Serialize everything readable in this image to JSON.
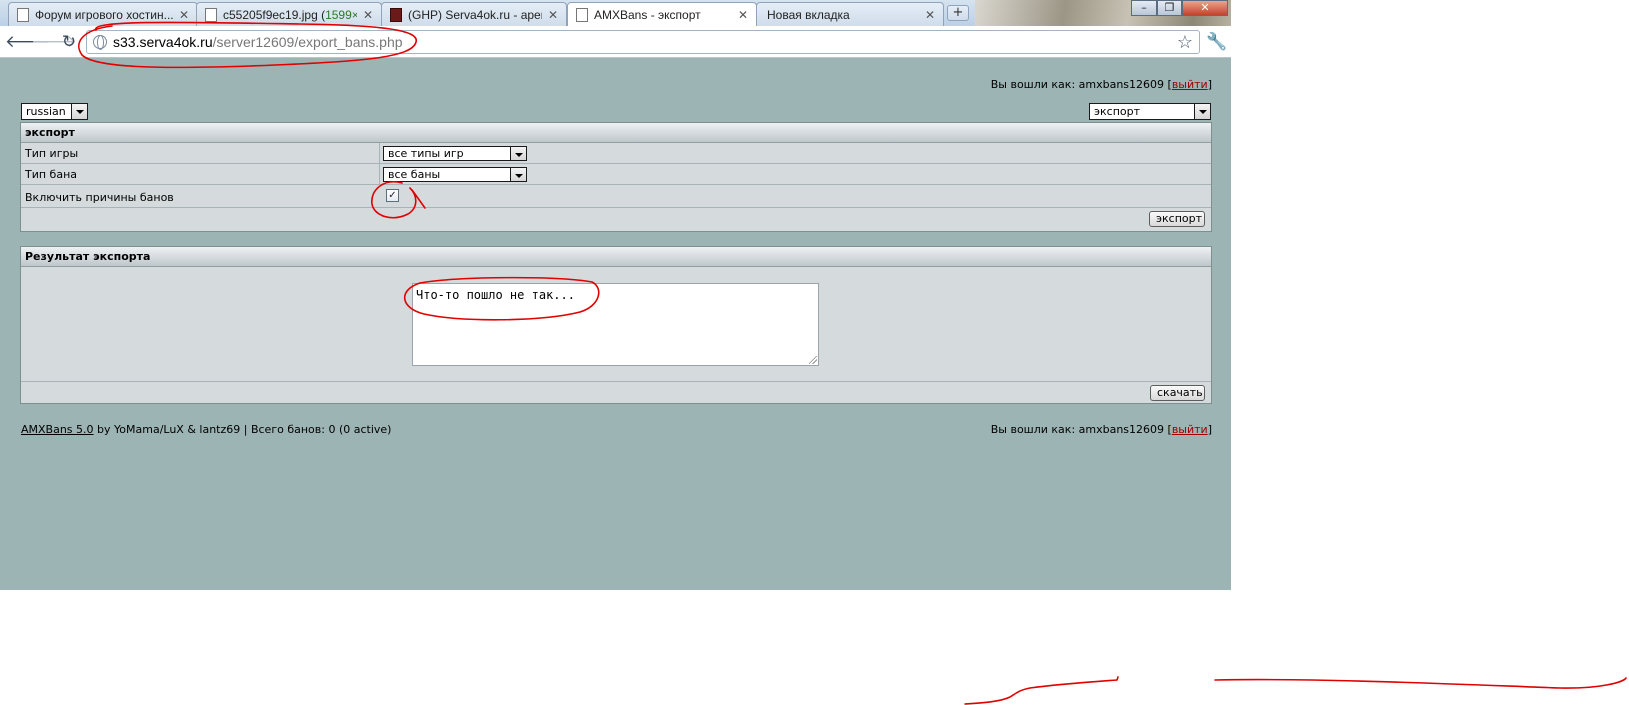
{
  "browser": {
    "tabs": [
      {
        "label": "Форум игрового хостин...",
        "icon": "page-icon",
        "active": false
      },
      {
        "label_a": "c55205f9ec19.jpg (",
        "label_b": "1599×...",
        "icon": "page-icon",
        "active": false
      },
      {
        "label": "(GHP) Serva4ok.ru - арен...",
        "icon": "ghp-favicon-icon",
        "active": false
      },
      {
        "label": "AMXBans - экспорт",
        "icon": "page-icon",
        "active": true
      },
      {
        "label": "Новая вкладка",
        "icon": "none",
        "active": false
      }
    ],
    "url_host": "s33.serva4ok.ru",
    "url_path": "/server12609/export_bans.php"
  },
  "page": {
    "login_prefix": "Вы вошли как: amxbans12609 [",
    "logout_link": "выйти",
    "login_suffix": "]",
    "language_select": "russian",
    "menu_select": "экспорт",
    "export_panel": {
      "title": "экспорт",
      "rows": [
        {
          "label": "Тип игры",
          "value": "все типы игр"
        },
        {
          "label": "Тип бана",
          "value": "все баны"
        },
        {
          "label": "Включить причины банов",
          "checked_mark": "✓"
        }
      ],
      "button": "экспорт"
    },
    "result_panel": {
      "title": "Результат экспорта",
      "text": "Что-то пошло не так...",
      "button": "скачать"
    },
    "footer": {
      "link": "AMXBans 5.0",
      "text": " by YoMama/LuX & lantz69 | Всего банов: 0 (0 active)"
    }
  },
  "colors": {
    "page_bg": "#9cb4b4",
    "panel_bg": "#d5dadd",
    "logout_link": "#a10000",
    "annotation": "#e00000"
  }
}
